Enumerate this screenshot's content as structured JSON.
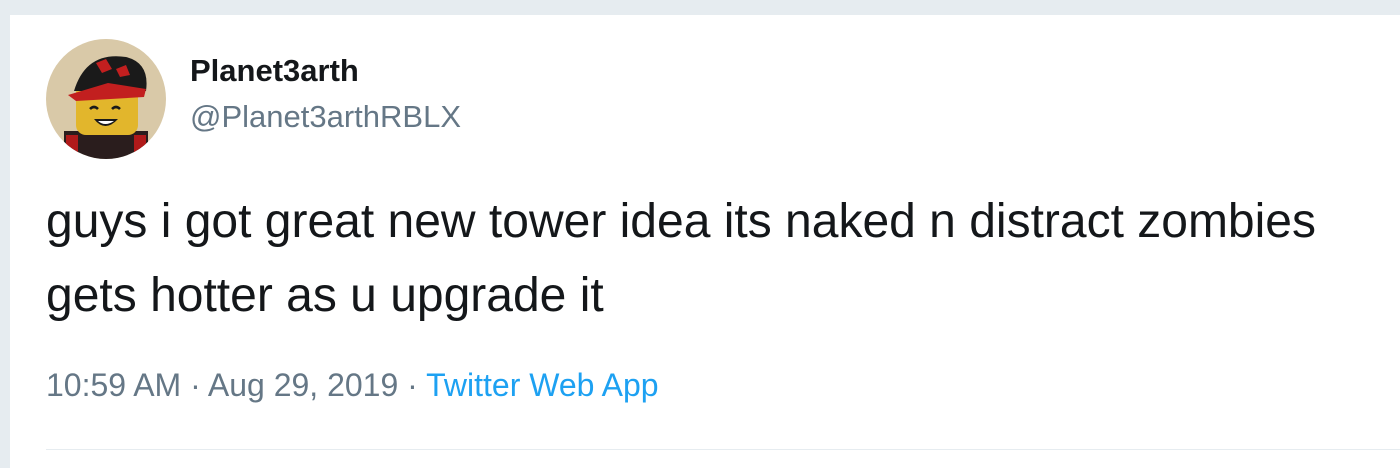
{
  "tweet": {
    "author_name": "Planet3arth",
    "author_handle": "@Planet3arthRBLX",
    "text": "guys i got great new tower idea its naked n distract zombies gets hotter as u upgrade it",
    "time": "10:59 AM",
    "separator": "·",
    "date": "Aug 29, 2019",
    "source": "Twitter Web App"
  },
  "colors": {
    "primary_text": "#14171a",
    "secondary_text": "#657786",
    "link": "#1da1f2",
    "border": "#e6ecf0"
  },
  "icons": {
    "avatar": "avatar-icon"
  }
}
